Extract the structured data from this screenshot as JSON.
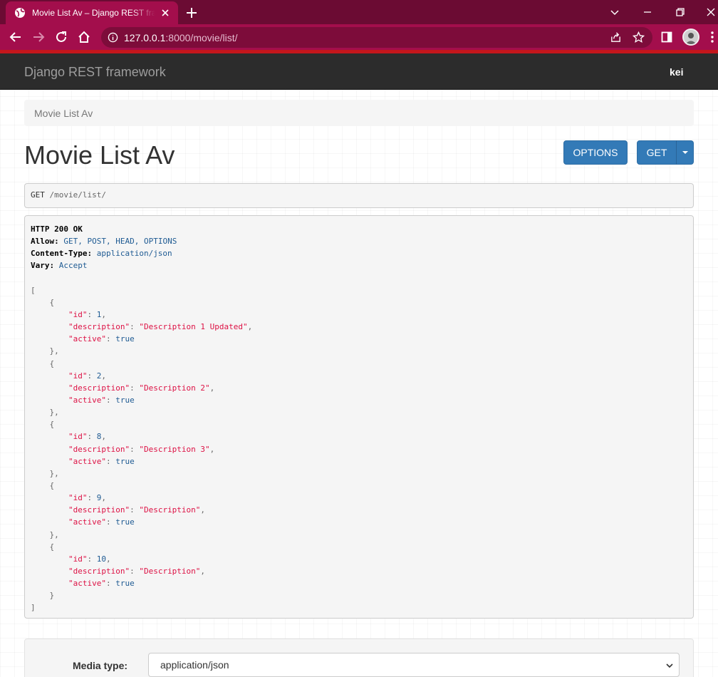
{
  "browser": {
    "tab_title": "Movie List Av – Django REST framework",
    "url_host": "127.0.0.1",
    "url_rest": ":8000/movie/list/",
    "colors": {
      "tabbar": "#6b0b33",
      "active_tab": "#a30e4c",
      "accent_line": "#c4161c"
    }
  },
  "navbar": {
    "brand": "Django REST framework",
    "user": "kei"
  },
  "breadcrumb": {
    "current": "Movie List Av"
  },
  "page_title": "Movie List Av",
  "buttons": {
    "options": "OPTIONS",
    "get": "GET"
  },
  "request": {
    "method": "GET",
    "path": "/movie/list/"
  },
  "response": {
    "status": "HTTP 200 OK",
    "headers": [
      {
        "name": "Allow:",
        "value": "GET, POST, HEAD, OPTIONS"
      },
      {
        "name": "Content-Type:",
        "value": "application/json"
      },
      {
        "name": "Vary:",
        "value": "Accept"
      }
    ],
    "items": [
      {
        "id": "1",
        "description": "\"Description 1 Updated\"",
        "active": "true"
      },
      {
        "id": "2",
        "description": "\"Description 2\"",
        "active": "true"
      },
      {
        "id": "8",
        "description": "\"Description 3\"",
        "active": "true"
      },
      {
        "id": "9",
        "description": "\"Description\"",
        "active": "true"
      },
      {
        "id": "10",
        "description": "\"Description\"",
        "active": "true"
      }
    ],
    "keys": {
      "id": "\"id\"",
      "description": "\"description\"",
      "active": "\"active\""
    }
  },
  "form": {
    "media_type_label": "Media type:",
    "media_type_value": "application/json"
  }
}
